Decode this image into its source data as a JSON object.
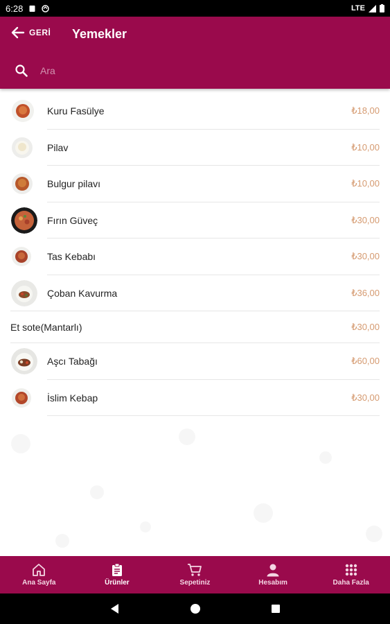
{
  "status_bar": {
    "time": "6:28",
    "network": "LTE"
  },
  "header": {
    "back_label": "GERİ",
    "title": "Yemekler",
    "search_placeholder": "Ara",
    "background_color": "#9a0a4c"
  },
  "menu_items": [
    {
      "name": "Kuru Fasülye",
      "price": "₺18,00",
      "image": "bean-stew-thumb"
    },
    {
      "name": "Pilav",
      "price": "₺10,00",
      "image": "rice-thumb"
    },
    {
      "name": "Bulgur pilavı",
      "price": "₺10,00",
      "image": "bulgur-thumb"
    },
    {
      "name": "Fırın Güveç",
      "price": "₺30,00",
      "image": "casserole-thumb"
    },
    {
      "name": "Tas Kebabı",
      "price": "₺30,00",
      "image": "tas-kebab-thumb"
    },
    {
      "name": "Çoban Kavurma",
      "price": "₺36,00",
      "image": "coban-kavurma-thumb"
    },
    {
      "name": "Et sote(Mantarlı)",
      "price": "₺30,00",
      "image": null
    },
    {
      "name": "Aşcı Tabağı",
      "price": "₺60,00",
      "image": "chef-plate-thumb"
    },
    {
      "name": "İslim Kebap",
      "price": "₺30,00",
      "image": "islim-kebab-thumb"
    }
  ],
  "bottom_nav": [
    {
      "label": "Ana Sayfa",
      "icon": "home-icon",
      "active": false
    },
    {
      "label": "Ürünler",
      "icon": "clipboard-icon",
      "active": true
    },
    {
      "label": "Sepetiniz",
      "icon": "cart-icon",
      "active": false
    },
    {
      "label": "Hesabım",
      "icon": "person-icon",
      "active": false
    },
    {
      "label": "Daha Fazla",
      "icon": "grid-icon",
      "active": false
    }
  ],
  "colors": {
    "accent": "#9a0a4c",
    "price": "#d59a70"
  }
}
